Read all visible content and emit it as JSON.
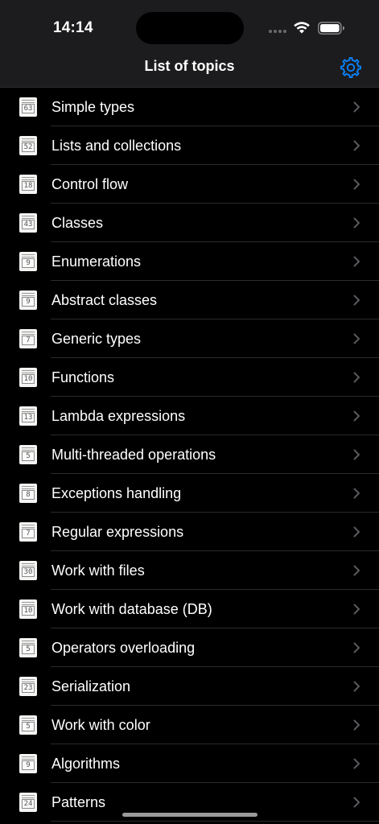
{
  "status_bar": {
    "time": "14:14"
  },
  "nav": {
    "title": "List of topics",
    "settings_icon": "gear-icon",
    "accent_color": "#0a84ff"
  },
  "topics": [
    {
      "count": "63",
      "label": "Simple types"
    },
    {
      "count": "52",
      "label": "Lists and collections"
    },
    {
      "count": "18",
      "label": "Control flow"
    },
    {
      "count": "43",
      "label": "Classes"
    },
    {
      "count": "9",
      "label": "Enumerations"
    },
    {
      "count": "9",
      "label": "Abstract classes"
    },
    {
      "count": "7",
      "label": "Generic types"
    },
    {
      "count": "10",
      "label": "Functions"
    },
    {
      "count": "13",
      "label": "Lambda expressions"
    },
    {
      "count": "5",
      "label": "Multi-threaded operations"
    },
    {
      "count": "8",
      "label": "Exceptions handling"
    },
    {
      "count": "7",
      "label": "Regular expressions"
    },
    {
      "count": "30",
      "label": "Work with files"
    },
    {
      "count": "10",
      "label": "Work with database (DB)"
    },
    {
      "count": "5",
      "label": "Operators overloading"
    },
    {
      "count": "23",
      "label": "Serialization"
    },
    {
      "count": "5",
      "label": "Work with color"
    },
    {
      "count": "9",
      "label": "Algorithms"
    },
    {
      "count": "24",
      "label": "Patterns"
    }
  ]
}
